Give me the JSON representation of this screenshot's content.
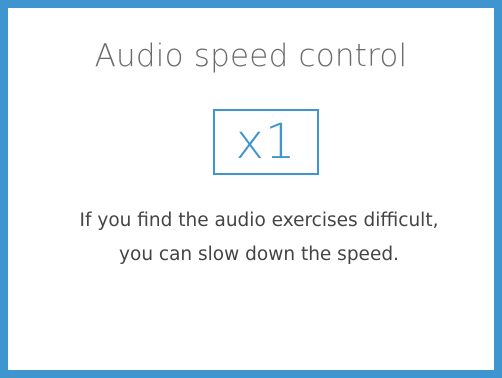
{
  "panel": {
    "title": "Audio speed control",
    "speed_value": "x1",
    "description_line1": "If you find the audio exercises difficult,",
    "description_line2": "you can slow down the speed."
  },
  "colors": {
    "accent": "#3f95cf",
    "title_text": "#6a6a6a",
    "body_text": "#444444",
    "background": "#ffffff"
  }
}
